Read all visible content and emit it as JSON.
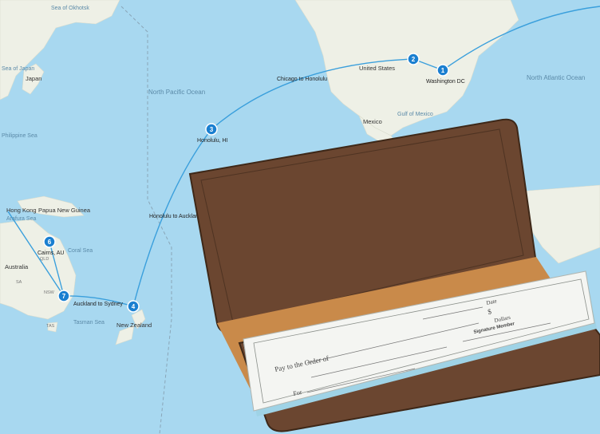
{
  "colors": {
    "water": "#a8d8f0",
    "land": "#eef0e6",
    "route": "#3a9fdc",
    "marker": "#1a7fd0",
    "leather": "#6b4630",
    "leather_dark": "#4e3322",
    "tan_lining": "#c98a4a",
    "check_paper": "#f4f5f2",
    "check_edge": "#9fd3e6"
  },
  "oceans": {
    "north_pacific": "North Pacific Ocean",
    "north_atlantic": "North Atlantic Ocean",
    "coral_sea": "Coral Sea",
    "tasman_sea": "Tasman Sea",
    "sea_of_japan": "Sea of Japan",
    "philippine_sea": "Philippine Sea",
    "arafura_sea": "Arafura Sea",
    "gulf_of_mexico": "Gulf of Mexico",
    "sea_of_okhotsk": "Sea of Okhotsk"
  },
  "places": {
    "united_states": "United States",
    "mexico": "Mexico",
    "japan": "Japan",
    "hong_kong": "Hong Kong",
    "papua_new_guinea": "Papua New Guinea",
    "australia": "Australia",
    "new_zealand": "New Zealand",
    "qld": "QLD",
    "nsw": "NSW",
    "sa": "SA",
    "tas": "TAS"
  },
  "markers": [
    {
      "number": "1",
      "label": "Washington DC"
    },
    {
      "number": "2",
      "label": "Chicago to Honolulu"
    },
    {
      "number": "3",
      "label": "Honolulu, HI"
    },
    {
      "number": "4",
      "label": "Honolulu to Auckland"
    },
    {
      "number": "6",
      "label": "Cairns, AU"
    },
    {
      "number": "7",
      "label": "Auckland to Sydney"
    }
  ],
  "check": {
    "pay_to": "Pay to the Order of",
    "dollar_sign": "$",
    "dollars": "Dollars",
    "date": "Date",
    "signature": "Signature Member",
    "for": "For"
  }
}
